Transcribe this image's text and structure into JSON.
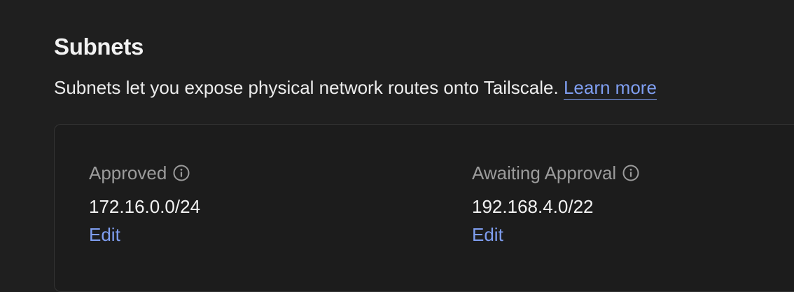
{
  "section": {
    "title": "Subnets",
    "description": "Subnets let you expose physical network routes onto Tailscale.",
    "learn_more": "Learn more"
  },
  "approved": {
    "label": "Approved",
    "icon": "info-icon",
    "value": "172.16.0.0/24",
    "edit": "Edit"
  },
  "awaiting": {
    "label": "Awaiting Approval",
    "icon": "info-icon",
    "value": "192.168.4.0/22",
    "edit": "Edit"
  },
  "colors": {
    "background": "#1f1f1f",
    "link": "#7f9ef0",
    "muted": "#9b9b9b",
    "text": "#f2f2f2"
  }
}
